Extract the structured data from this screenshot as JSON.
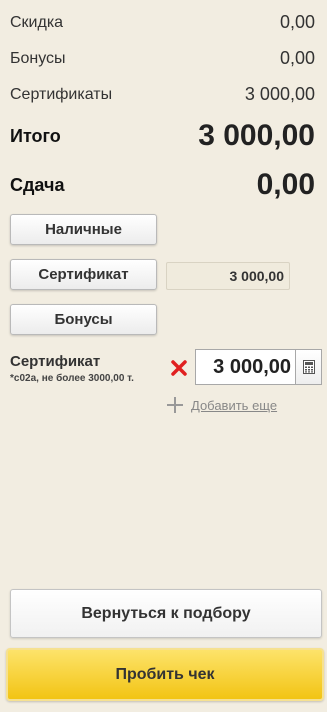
{
  "summary": {
    "discount_label": "Скидка",
    "discount_value": "0,00",
    "bonuses_label": "Бонусы",
    "bonuses_value": "0,00",
    "certificates_label": "Сертификаты",
    "certificates_value": "3 000,00",
    "total_label": "Итого",
    "total_value": "3 000,00",
    "change_label": "Сдача",
    "change_value": "0,00"
  },
  "payment_buttons": {
    "cash": "Наличные",
    "certificate": "Сертификат",
    "certificate_amount": "3 000,00",
    "bonuses": "Бонусы"
  },
  "certificate_entry": {
    "title": "Сертификат",
    "subtitle": "*c02a, не более 3000,00 т.",
    "amount": "3 000,00",
    "remove_icon": "red-x-icon",
    "calculator_icon": "calculator-icon"
  },
  "add_more": {
    "label": "Добавить еще",
    "icon": "plus-icon"
  },
  "actions": {
    "back_label": "Вернуться к подбору",
    "print_receipt_label": "Пробить чек"
  },
  "colors": {
    "background": "#f2ede1",
    "primary_button": "#f2c414",
    "remove": "#e02020"
  }
}
